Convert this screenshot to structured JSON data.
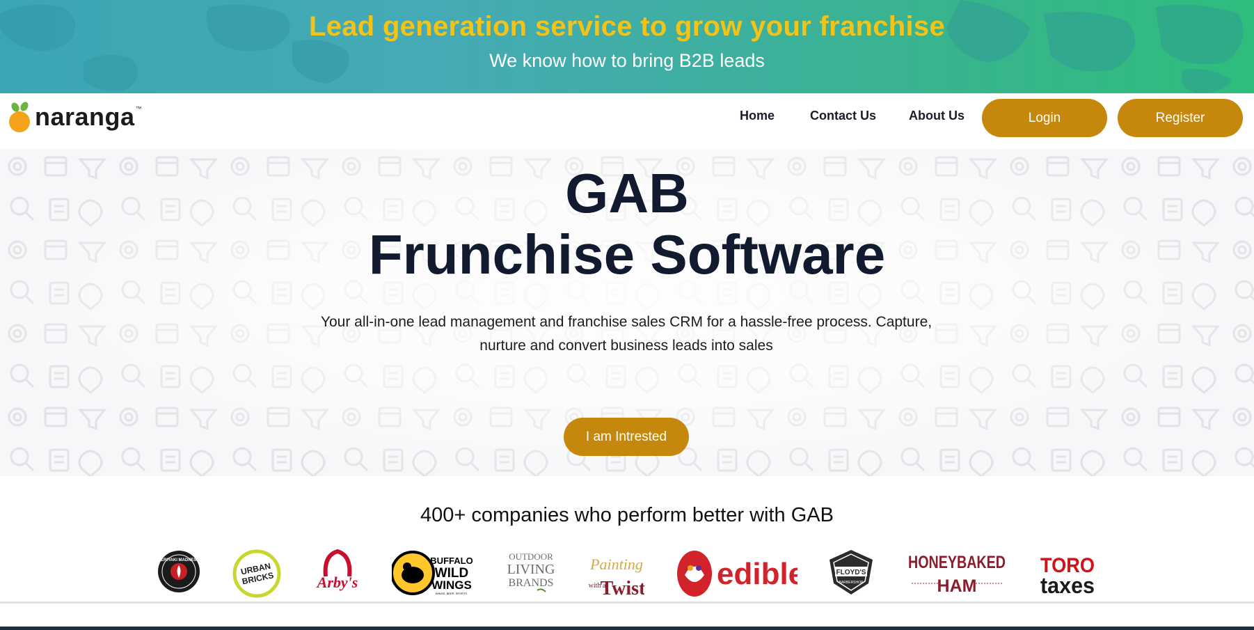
{
  "banner": {
    "title": "Lead generation service to grow your franchise",
    "subtitle": "We know how to bring B2B leads"
  },
  "navbar": {
    "logo_text": "naranga",
    "logo_tm": "™",
    "links": [
      "Home",
      "Contact Us",
      "About Us"
    ],
    "login_label": "Login",
    "register_label": "Register"
  },
  "hero": {
    "title_line1": "GAB",
    "title_line2": "Frunchise Software",
    "description": "Your all-in-one lead management and franchise sales CRM for a hassle-free process. Capture, nurture and convert business leads into sales",
    "cta_label": "I am Intrested"
  },
  "companies": {
    "heading": "400+ companies who perform better with GAB",
    "logos": {
      "teriyaki": "TERIYAKI MADNESS",
      "urban_bricks_1": "URBAN",
      "urban_bricks_2": "BRICKS",
      "arbys": "Arby's",
      "bww_1": "BUFFALO",
      "bww_2": "WILD",
      "bww_3": "WINGS",
      "bww_tag": "WINGS. BEER. SPORTS.",
      "outdoor_1": "OUTDOOR",
      "outdoor_2": "LIVING",
      "outdoor_3": "BRANDS",
      "painting_1": "Painting",
      "painting_2": "with a",
      "painting_3": "Twist",
      "edible": "edible",
      "floyds_1": "FLOYD'S",
      "floyds_2": "BARBERSHOP",
      "honeybaked_1": "HONEYBAKED",
      "honeybaked_2": "HAM",
      "toro_1": "TORO",
      "toro_2": "taxes"
    }
  },
  "colors": {
    "accent": "#c6880c",
    "banner_title": "#f2c318",
    "heading": "#111a2e",
    "banner_gradient_start": "#3aa6b4",
    "banner_gradient_end": "#2fbd7c",
    "orange": "#f5a21b",
    "leaf": "#6cb33f"
  }
}
